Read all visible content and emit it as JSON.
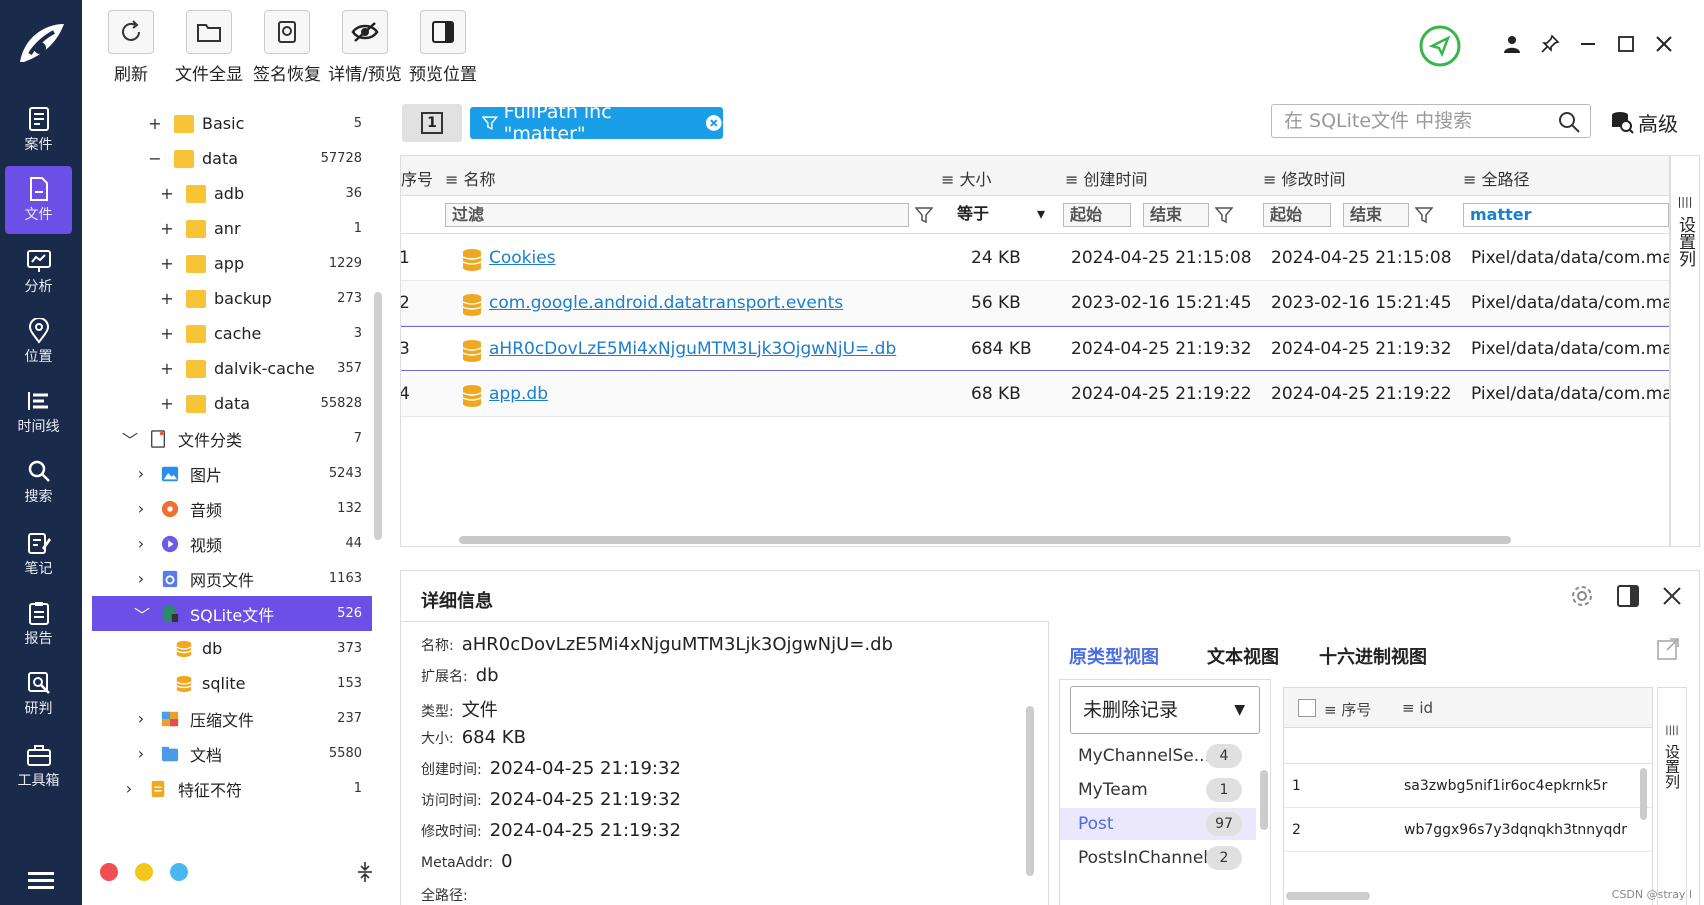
{
  "nav": {
    "items": [
      {
        "label": "案件",
        "icon": "case-icon"
      },
      {
        "label": "文件",
        "icon": "file-icon"
      },
      {
        "label": "分析",
        "icon": "analysis-icon"
      },
      {
        "label": "位置",
        "icon": "location-icon"
      },
      {
        "label": "时间线",
        "icon": "timeline-icon"
      },
      {
        "label": "搜索",
        "icon": "search-icon"
      },
      {
        "label": "笔记",
        "icon": "note-icon"
      },
      {
        "label": "报告",
        "icon": "report-icon"
      },
      {
        "label": "研判",
        "icon": "judge-icon"
      },
      {
        "label": "工具箱",
        "icon": "toolbox-icon"
      }
    ],
    "active": "文件"
  },
  "toolbar": {
    "refresh": "刷新",
    "show_all": "文件全显",
    "sign_restore": "签名恢复",
    "detail_preview": "详情/预览",
    "preview_position": "预览位置"
  },
  "tree": {
    "basic": {
      "label": "Basic",
      "count": "5"
    },
    "data": {
      "label": "data",
      "count": "57728"
    },
    "adb": {
      "label": "adb",
      "count": "36"
    },
    "anr": {
      "label": "anr",
      "count": "1"
    },
    "app": {
      "label": "app",
      "count": "1229"
    },
    "backup": {
      "label": "backup",
      "count": "273"
    },
    "cache": {
      "label": "cache",
      "count": "3"
    },
    "dalvik": {
      "label": "dalvik-cache",
      "count": "357"
    },
    "data2": {
      "label": "data",
      "count": "55828"
    },
    "category": {
      "label": "文件分类",
      "count": "7"
    },
    "images": {
      "label": "图片",
      "count": "5243"
    },
    "audio": {
      "label": "音频",
      "count": "132"
    },
    "video": {
      "label": "视频",
      "count": "44"
    },
    "web": {
      "label": "网页文件",
      "count": "1163"
    },
    "sqlite": {
      "label": "SQLite文件",
      "count": "526"
    },
    "db": {
      "label": "db",
      "count": "373"
    },
    "sqlite_ext": {
      "label": "sqlite",
      "count": "153"
    },
    "archive": {
      "label": "压缩文件",
      "count": "237"
    },
    "docs": {
      "label": "文档",
      "count": "5580"
    },
    "mismatch": {
      "label": "特征不符",
      "count": "1"
    }
  },
  "filter": {
    "tab_number": "1",
    "chip": "FullPath inc \"matter\"",
    "search_placeholder": "在 SQLite文件 中搜索",
    "advanced": "高级"
  },
  "grid": {
    "headers": {
      "index": "序号",
      "name": "名称",
      "size": "大小",
      "created": "创建时间",
      "modified": "修改时间",
      "path": "全路径"
    },
    "filter_row": {
      "name": "过滤",
      "size_op": "等于",
      "start": "起始",
      "end": "结束",
      "start2": "起始",
      "end2": "结束",
      "path": "matter"
    },
    "rows": [
      {
        "idx": "1",
        "name": "Cookies",
        "size": "24 KB",
        "created": "2024-04-25 21:15:08",
        "modified": "2024-04-25 21:15:08",
        "path": "Pixel/data/data/com.matt"
      },
      {
        "idx": "2",
        "name": "com.google.android.datatransport.events",
        "size": "56 KB",
        "created": "2023-02-16 15:21:45",
        "modified": "2023-02-16 15:21:45",
        "path": "Pixel/data/data/com.matt"
      },
      {
        "idx": "3",
        "name": "aHR0cDovLzE5Mi4xNjguMTM3Ljk3OjgwNjU=.db",
        "size": "684 KB",
        "created": "2024-04-25 21:19:32",
        "modified": "2024-04-25 21:19:32",
        "path": "Pixel/data/data/com.matt"
      },
      {
        "idx": "4",
        "name": "app.db",
        "size": "68 KB",
        "created": "2024-04-25 21:19:22",
        "modified": "2024-04-25 21:19:22",
        "path": "Pixel/data/data/com.matt"
      }
    ],
    "set_columns": "设置列"
  },
  "detail": {
    "title": "详细信息",
    "props": [
      {
        "k": "名称:",
        "v": "aHR0cDovLzE5Mi4xNjguMTM3Ljk3OjgwNjU=.db"
      },
      {
        "k": "扩展名:",
        "v": "db"
      },
      {
        "k": "类型:",
        "v": "文件"
      },
      {
        "k": "大小:",
        "v": "684 KB"
      },
      {
        "k": "创建时间:",
        "v": "2024-04-25 21:19:32"
      },
      {
        "k": "访问时间:",
        "v": "2024-04-25 21:19:32"
      },
      {
        "k": "修改时间:",
        "v": "2024-04-25 21:19:32"
      },
      {
        "k": "MetaAddr:",
        "v": "0"
      },
      {
        "k": "全路径:",
        "v": ""
      }
    ],
    "tabs": {
      "native": "原类型视图",
      "text": "文本视图",
      "hex": "十六进制视图"
    },
    "dropdown": "未删除记录",
    "tables": [
      {
        "name": "MyChannelSe...",
        "count": "4"
      },
      {
        "name": "MyTeam",
        "count": "1"
      },
      {
        "name": "Post",
        "count": "97"
      },
      {
        "name": "PostsInChannel",
        "count": "2"
      }
    ],
    "sub_headers": {
      "index": "序号",
      "id": "id"
    },
    "sub_rows": [
      {
        "idx": "1",
        "id": "sa3zwbg5nif1ir6oc4epkrnk5r"
      },
      {
        "idx": "2",
        "id": "wb7ggx96s7y3dqnqkh3tnnyqdr"
      }
    ],
    "set_columns": "设置列"
  },
  "watermark": "CSDN @stray l",
  "colors": {
    "nav_bg": "#1a2a4a",
    "accent": "#6b4fe6",
    "chip": "#1a9ee8",
    "link": "#1a7fd0",
    "folder": "#f7c437"
  }
}
